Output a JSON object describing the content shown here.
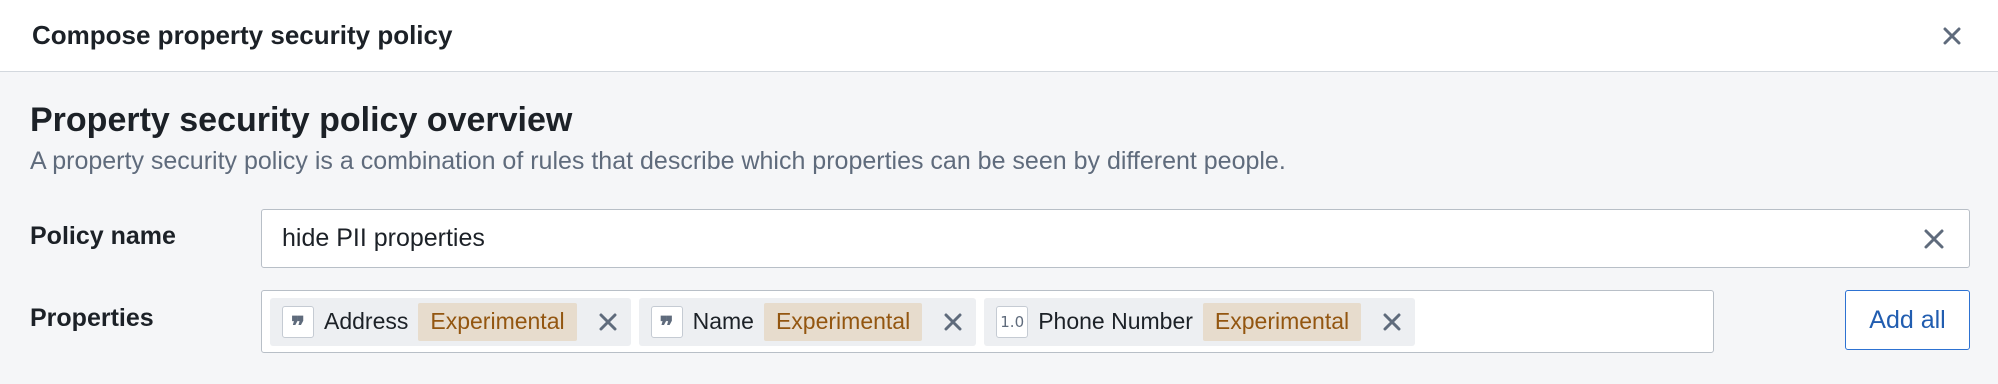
{
  "dialog": {
    "title": "Compose property security policy",
    "close_icon": "close-icon"
  },
  "overview": {
    "title": "Property security policy overview",
    "description": "A property security policy is a combination of rules that describe which properties can be seen by different people."
  },
  "policy_name": {
    "label": "Policy name",
    "value": "hide PII properties",
    "clear_icon": "close-icon"
  },
  "properties": {
    "label": "Properties",
    "tags": [
      {
        "type_icon": "string-type-icon",
        "type_glyph": "❞",
        "name": "Address",
        "badge": "Experimental"
      },
      {
        "type_icon": "string-type-icon",
        "type_glyph": "❞",
        "name": "Name",
        "badge": "Experimental"
      },
      {
        "type_icon": "numeric-type-icon",
        "type_glyph": "1.0",
        "name": "Phone Number",
        "badge": "Experimental"
      }
    ],
    "add_all_label": "Add all"
  },
  "colors": {
    "accent": "#2d72d2",
    "badge_bg": "#e7dccd",
    "badge_text": "#935610",
    "tag_bg": "#edeff2",
    "panel_bg": "#f5f6f8"
  }
}
